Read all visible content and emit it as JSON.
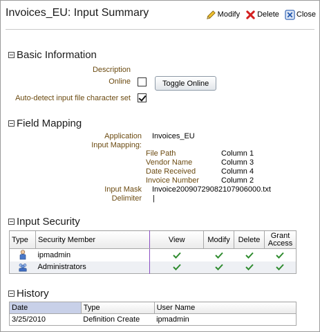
{
  "header": {
    "title": "Invoices_EU: Input Summary",
    "actions": [
      {
        "icon": "pencil-icon",
        "label": "Modify"
      },
      {
        "icon": "red-x-icon",
        "label": "Delete"
      },
      {
        "icon": "close-window-icon",
        "label": "Close"
      }
    ]
  },
  "basic_info": {
    "title": "Basic Information",
    "description_label": "Description",
    "description_value": "",
    "online_label": "Online",
    "online_checked": false,
    "toggle_button": "Toggle Online",
    "autodetect_label": "Auto-detect input file character set",
    "autodetect_checked": true
  },
  "field_mapping": {
    "title": "Field Mapping",
    "application_label": "Application",
    "application_value": "Invoices_EU",
    "input_mapping_label": "Input Mapping:",
    "mappings": [
      {
        "field": "File Path",
        "column": "Column 1"
      },
      {
        "field": "Vendor Name",
        "column": "Column 3"
      },
      {
        "field": "Date Received",
        "column": "Column 4"
      },
      {
        "field": "Invoice Number",
        "column": "Column 2"
      }
    ],
    "input_mask_label": "Input Mask",
    "input_mask_value": "Invoice20090729082107906000.txt",
    "delimiter_label": "Delimiter",
    "delimiter_value": "|"
  },
  "input_security": {
    "title": "Input Security",
    "columns": [
      "Type",
      "Security Member",
      "View",
      "Modify",
      "Delete",
      "Grant Access"
    ],
    "rows": [
      {
        "type_icon": "user-icon",
        "member": "ipmadmin",
        "view": true,
        "modify": true,
        "delete": true,
        "grant": true
      },
      {
        "type_icon": "group-icon",
        "member": "Administrators",
        "view": true,
        "modify": true,
        "delete": true,
        "grant": true
      }
    ]
  },
  "history": {
    "title": "History",
    "columns": [
      "Date",
      "Type",
      "User Name"
    ],
    "rows": [
      {
        "date": "3/25/2010",
        "type": "Definition Create",
        "user": "ipmadmin"
      }
    ]
  },
  "colors": {
    "label_brown": "#6b4a10",
    "check_green": "#2e8b2e",
    "delete_red": "#d42020",
    "close_blue": "#2a5db0",
    "divider_purple": "#8a4ec2"
  }
}
